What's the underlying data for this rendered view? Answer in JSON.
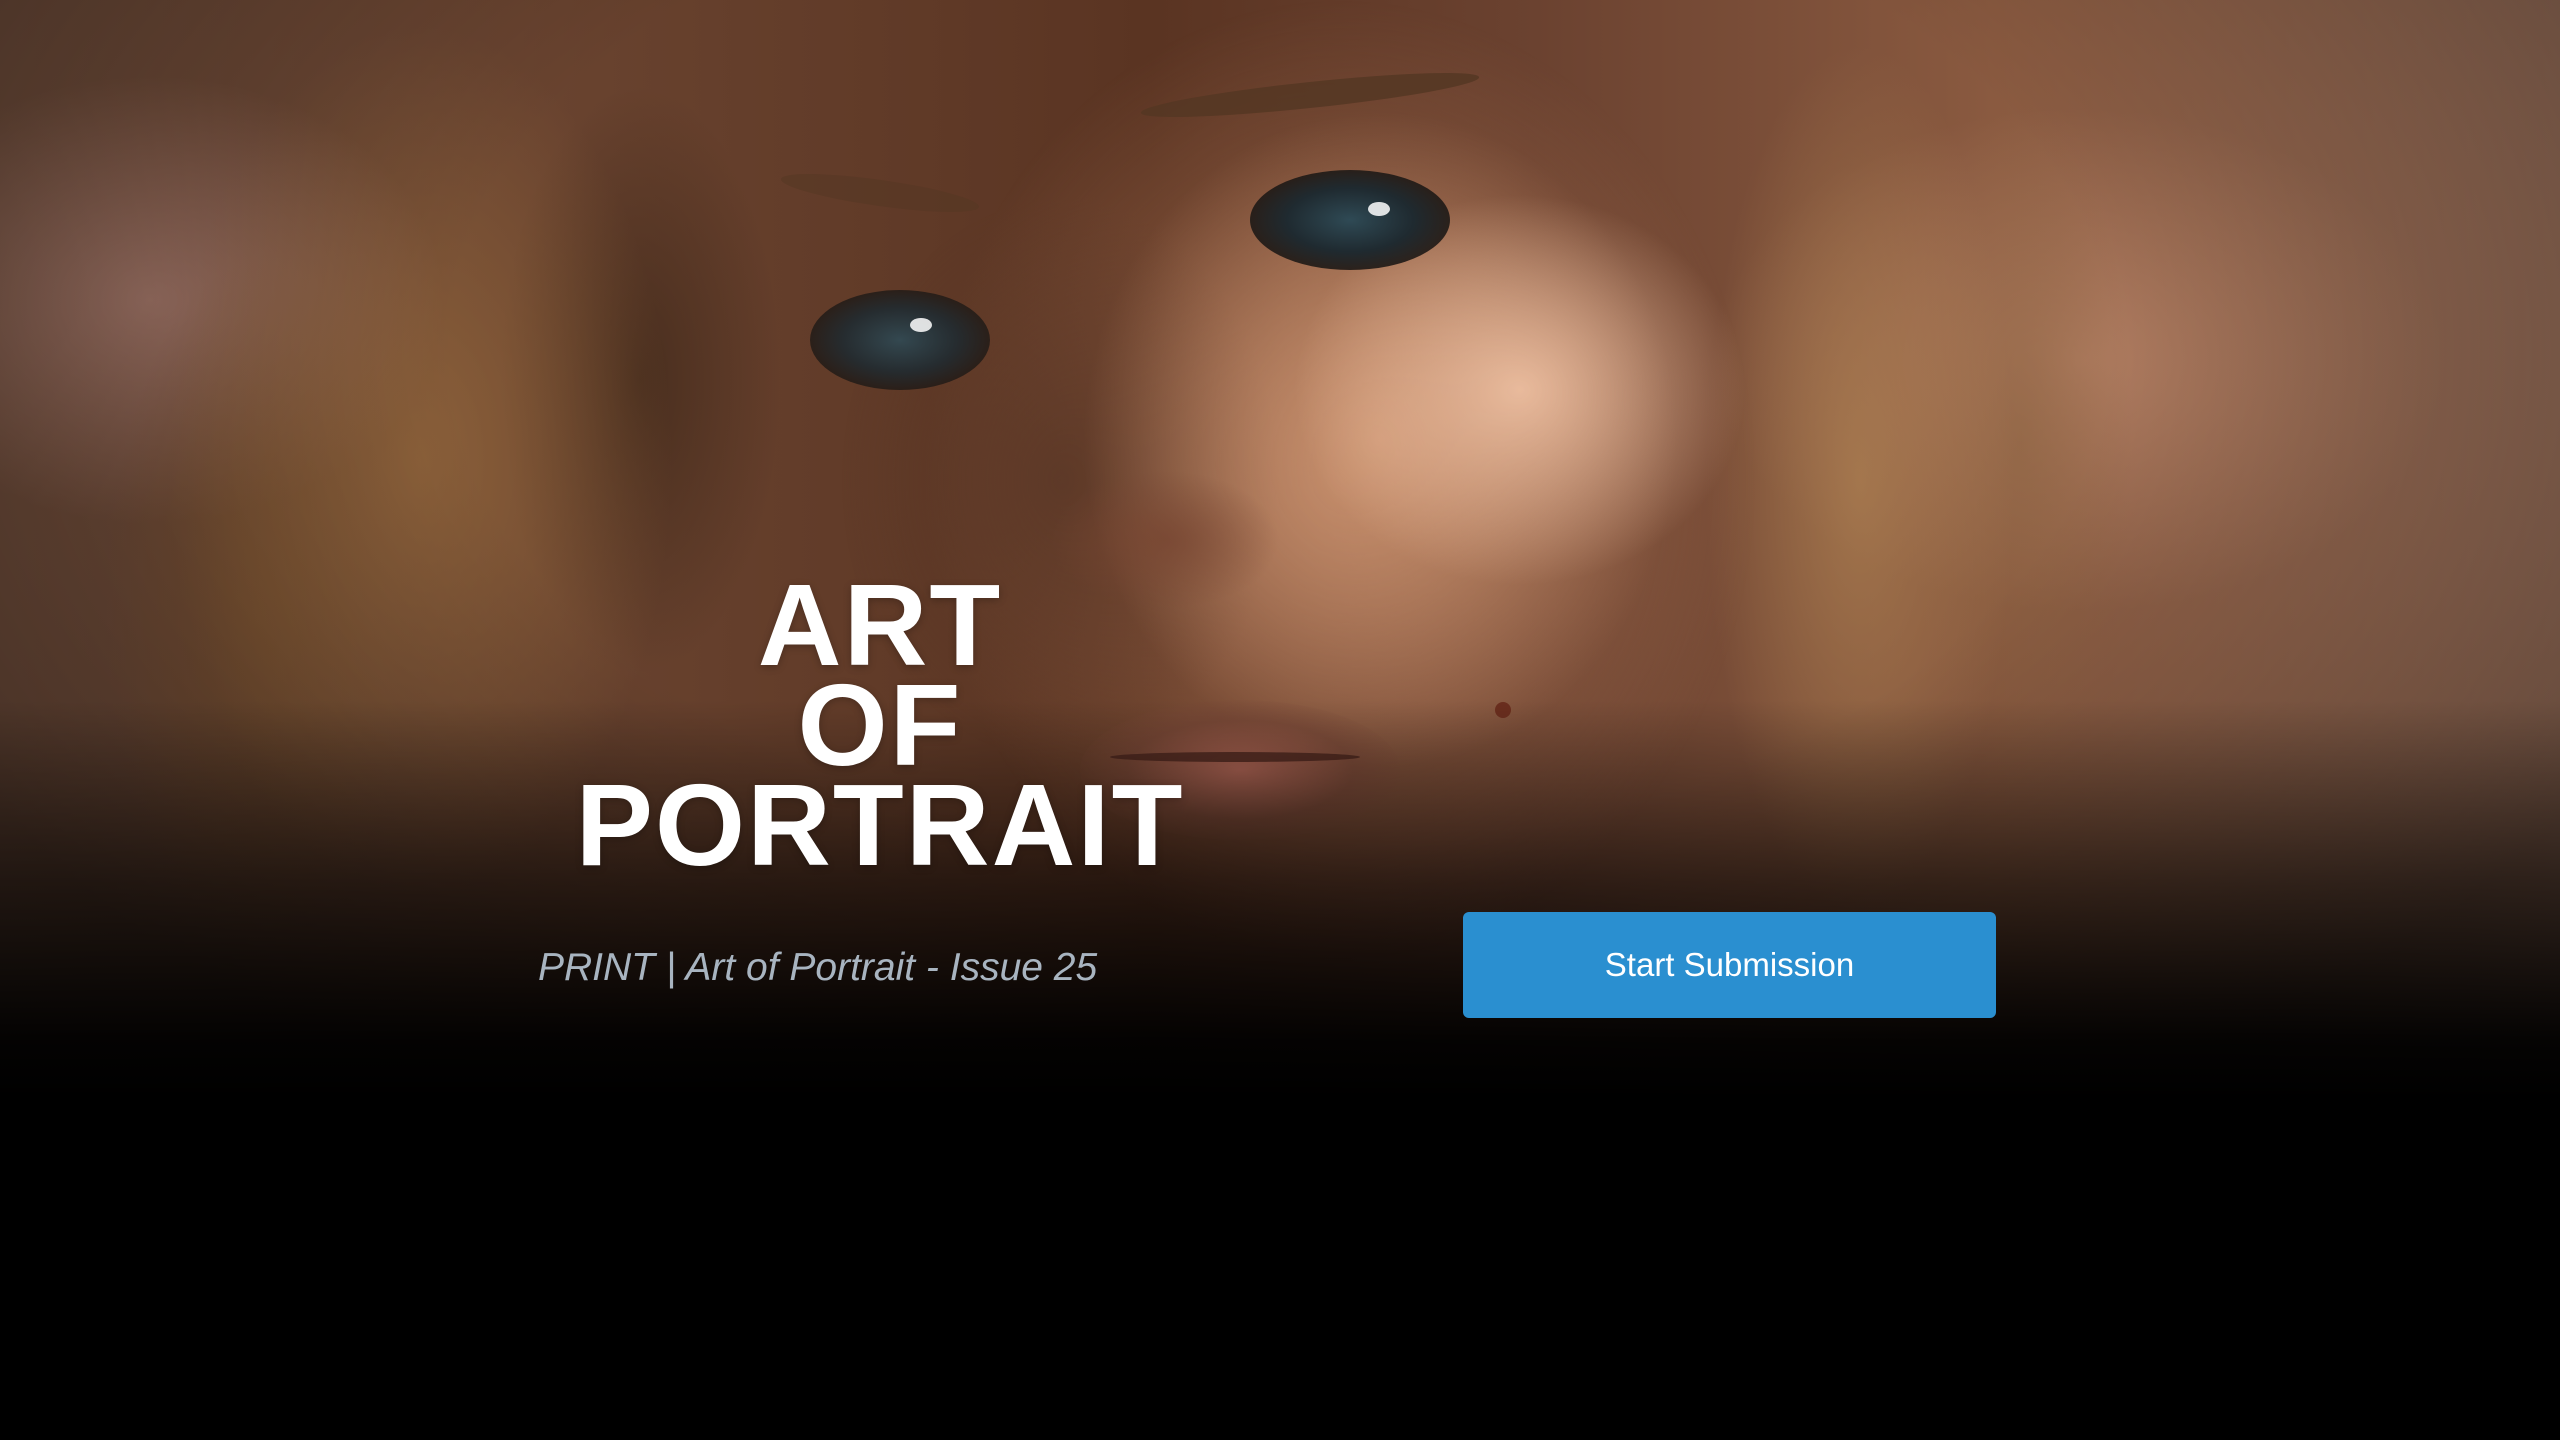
{
  "hero": {
    "title_lines": [
      "ART",
      "OF",
      "PORTRAIT"
    ],
    "subtitle": "PRINT | Art of Portrait - Issue 25",
    "cta_label": "Start Submission"
  },
  "colors": {
    "cta_background": "#2a8fd0",
    "cta_text": "#ffffff",
    "title_text": "#ffffff",
    "subtitle_text": "#a8b4c0",
    "page_background": "#000000"
  }
}
